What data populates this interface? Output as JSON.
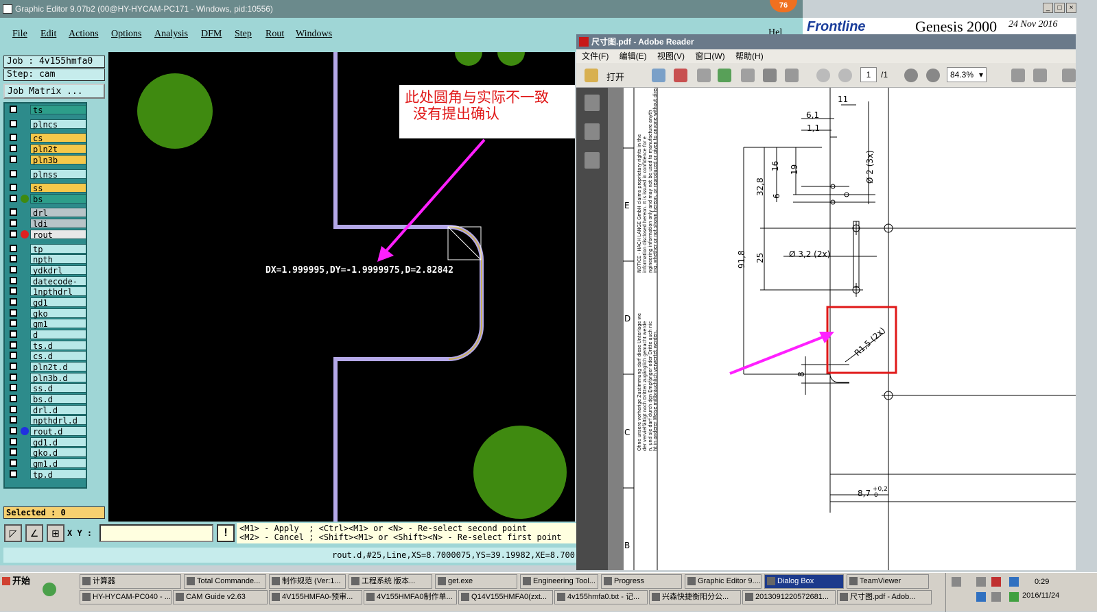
{
  "ge_window": {
    "title": "Graphic Editor 9.07b2 (00@HY-HYCAM-PC171 - Windows, pid:10556)",
    "badge": "76",
    "menu": [
      "File",
      "Edit",
      "Actions",
      "Options",
      "Analysis",
      "DFM",
      "Step",
      "Rout",
      "Windows"
    ],
    "banner_logo": "Frontline",
    "banner_title": "Genesis 2000",
    "banner_date": "24 Nov 2016",
    "help_fragment": "Hel"
  },
  "left_panel": {
    "job": "Job : 4v155hmfa0",
    "step": "Step: cam",
    "job_matrix": "Job Matrix ...",
    "selected": "Selected : 0",
    "layers": [
      {
        "name": "ts",
        "color": "#2d9e8a"
      },
      {
        "name": "plncs",
        "color": "#b8e8e8"
      },
      {
        "name": "cs",
        "color": "#f6c84a"
      },
      {
        "name": "pln2t",
        "color": "#f6c84a"
      },
      {
        "name": "pln3b",
        "color": "#f6c84a"
      },
      {
        "name": "plnss",
        "color": "#b8e8e8"
      },
      {
        "name": "ss",
        "color": "#f6c84a"
      },
      {
        "name": "bs",
        "color": "#2d9e8a"
      },
      {
        "name": "drl",
        "color": "#b8c4c8"
      },
      {
        "name": "ldi",
        "color": "#b8c4c8"
      },
      {
        "name": "rout",
        "color": "#e8e8e8"
      },
      {
        "name": "tp",
        "color": "#b8e8e8"
      },
      {
        "name": "npth",
        "color": "#b8e8e8"
      },
      {
        "name": "ydkdrl",
        "color": "#b8e8e8"
      },
      {
        "name": "datecode-bs",
        "color": "#b8e8e8"
      },
      {
        "name": "1npthdrl",
        "color": "#b8e8e8"
      },
      {
        "name": "gd1",
        "color": "#b8e8e8"
      },
      {
        "name": "gko",
        "color": "#b8e8e8"
      },
      {
        "name": "gm1",
        "color": "#b8e8e8"
      },
      {
        "name": "d",
        "color": "#b8e8e8"
      },
      {
        "name": "ts.d",
        "color": "#b8e8e8"
      },
      {
        "name": "cs.d",
        "color": "#b8e8e8"
      },
      {
        "name": "pln2t.d",
        "color": "#b8e8e8"
      },
      {
        "name": "pln3b.d",
        "color": "#b8e8e8"
      },
      {
        "name": "ss.d",
        "color": "#b8e8e8"
      },
      {
        "name": "bs.d",
        "color": "#b8e8e8"
      },
      {
        "name": "drl.d",
        "color": "#b8e8e8"
      },
      {
        "name": "npthdrl.d",
        "color": "#b8e8e8"
      },
      {
        "name": "rout.d",
        "color": "#b8e8e8"
      },
      {
        "name": "gd1.d",
        "color": "#b8e8e8"
      },
      {
        "name": "gko.d",
        "color": "#b8e8e8"
      },
      {
        "name": "gm1.d",
        "color": "#b8e8e8"
      },
      {
        "name": "tp.d",
        "color": "#b8e8e8"
      }
    ]
  },
  "canvas": {
    "annotation_line1": "此处圆角与实际不一致",
    "annotation_line2": "没有提出确认",
    "measure_text": "DX=1.999995,DY=-1.9999975,D=2.82842"
  },
  "command": {
    "xy_label": "X Y :",
    "excl": "!",
    "hint": "<M1> - Apply  ; <Ctrl><M1> or <N> - Re-select second point\n<M2> - Cancel ; <Shift><M1> or <Shift><N> - Re-select first point",
    "status": "rout.d,#25,Line,XS=8.7000075,YS=39.19982,XE=8.700"
  },
  "reader": {
    "title": "尺寸图.pdf - Adobe Reader",
    "menu": [
      "文件(F)",
      "编辑(E)",
      "视图(V)",
      "窗口(W)",
      "帮助(H)"
    ],
    "open_label": "打开",
    "page": "1",
    "page_total": "/1",
    "zoom": "84.3%",
    "dims": {
      "d11": "11",
      "d61": "6,1",
      "d11b": "1,1",
      "d16": "16",
      "d19": "19",
      "d2": "Ø 2 (3x)",
      "d328": "32,8",
      "d6": "6",
      "d918": "91,8",
      "d25": "25",
      "d32": "Ø 3,2 (2x)",
      "r15": "R1,5 (2x)",
      "d8": "8",
      "d87": "8,7",
      "tol": "+0,2",
      "tol0": "0"
    },
    "zones": [
      "E",
      "D",
      "C",
      "B"
    ],
    "notice_text": "NOTICE - HACH LANGE GmbH claims proprietary rights in the information disclosed hereon. It is issued in confidence for engineering information only and may not be used to manufacture anything, whether or not shown hereon, or reproduced or given to anyone without direct permission from HACH LANGE GmbH.",
    "german_text": "Ohne unsere vorherige Zustimmung darf diese Unterlage weder vervielfältigt noch Dritten zugänglich gemacht werden, und sie darf durch den Empfänger oder Dritte auch nicht in anderer Weise mißbräuchlich verwertet werden."
  },
  "taskbar": {
    "start": "开始",
    "row1": [
      "计算器",
      "Total Commande...",
      "制作规范 (Ver:1...",
      "工程系统 版本...",
      "get.exe",
      "Engineering Tool...",
      "Progress",
      "Graphic Editor 9....",
      "Dialog Box",
      "TeamViewer"
    ],
    "row2": [
      "HY-HYCAM-PC040 - ...",
      "CAM Guide v2.63",
      "4V155HMFA0-预审...",
      "4V155HMFA0制作单...",
      "Q14V155HMFA0(zxt...",
      "4v155hmfa0.txt - 记...",
      "兴森快捷衡阳分公...",
      "2013091220572681...",
      "尺寸图.pdf - Adob..."
    ],
    "time": "0:29",
    "date": "2016/11/24"
  }
}
